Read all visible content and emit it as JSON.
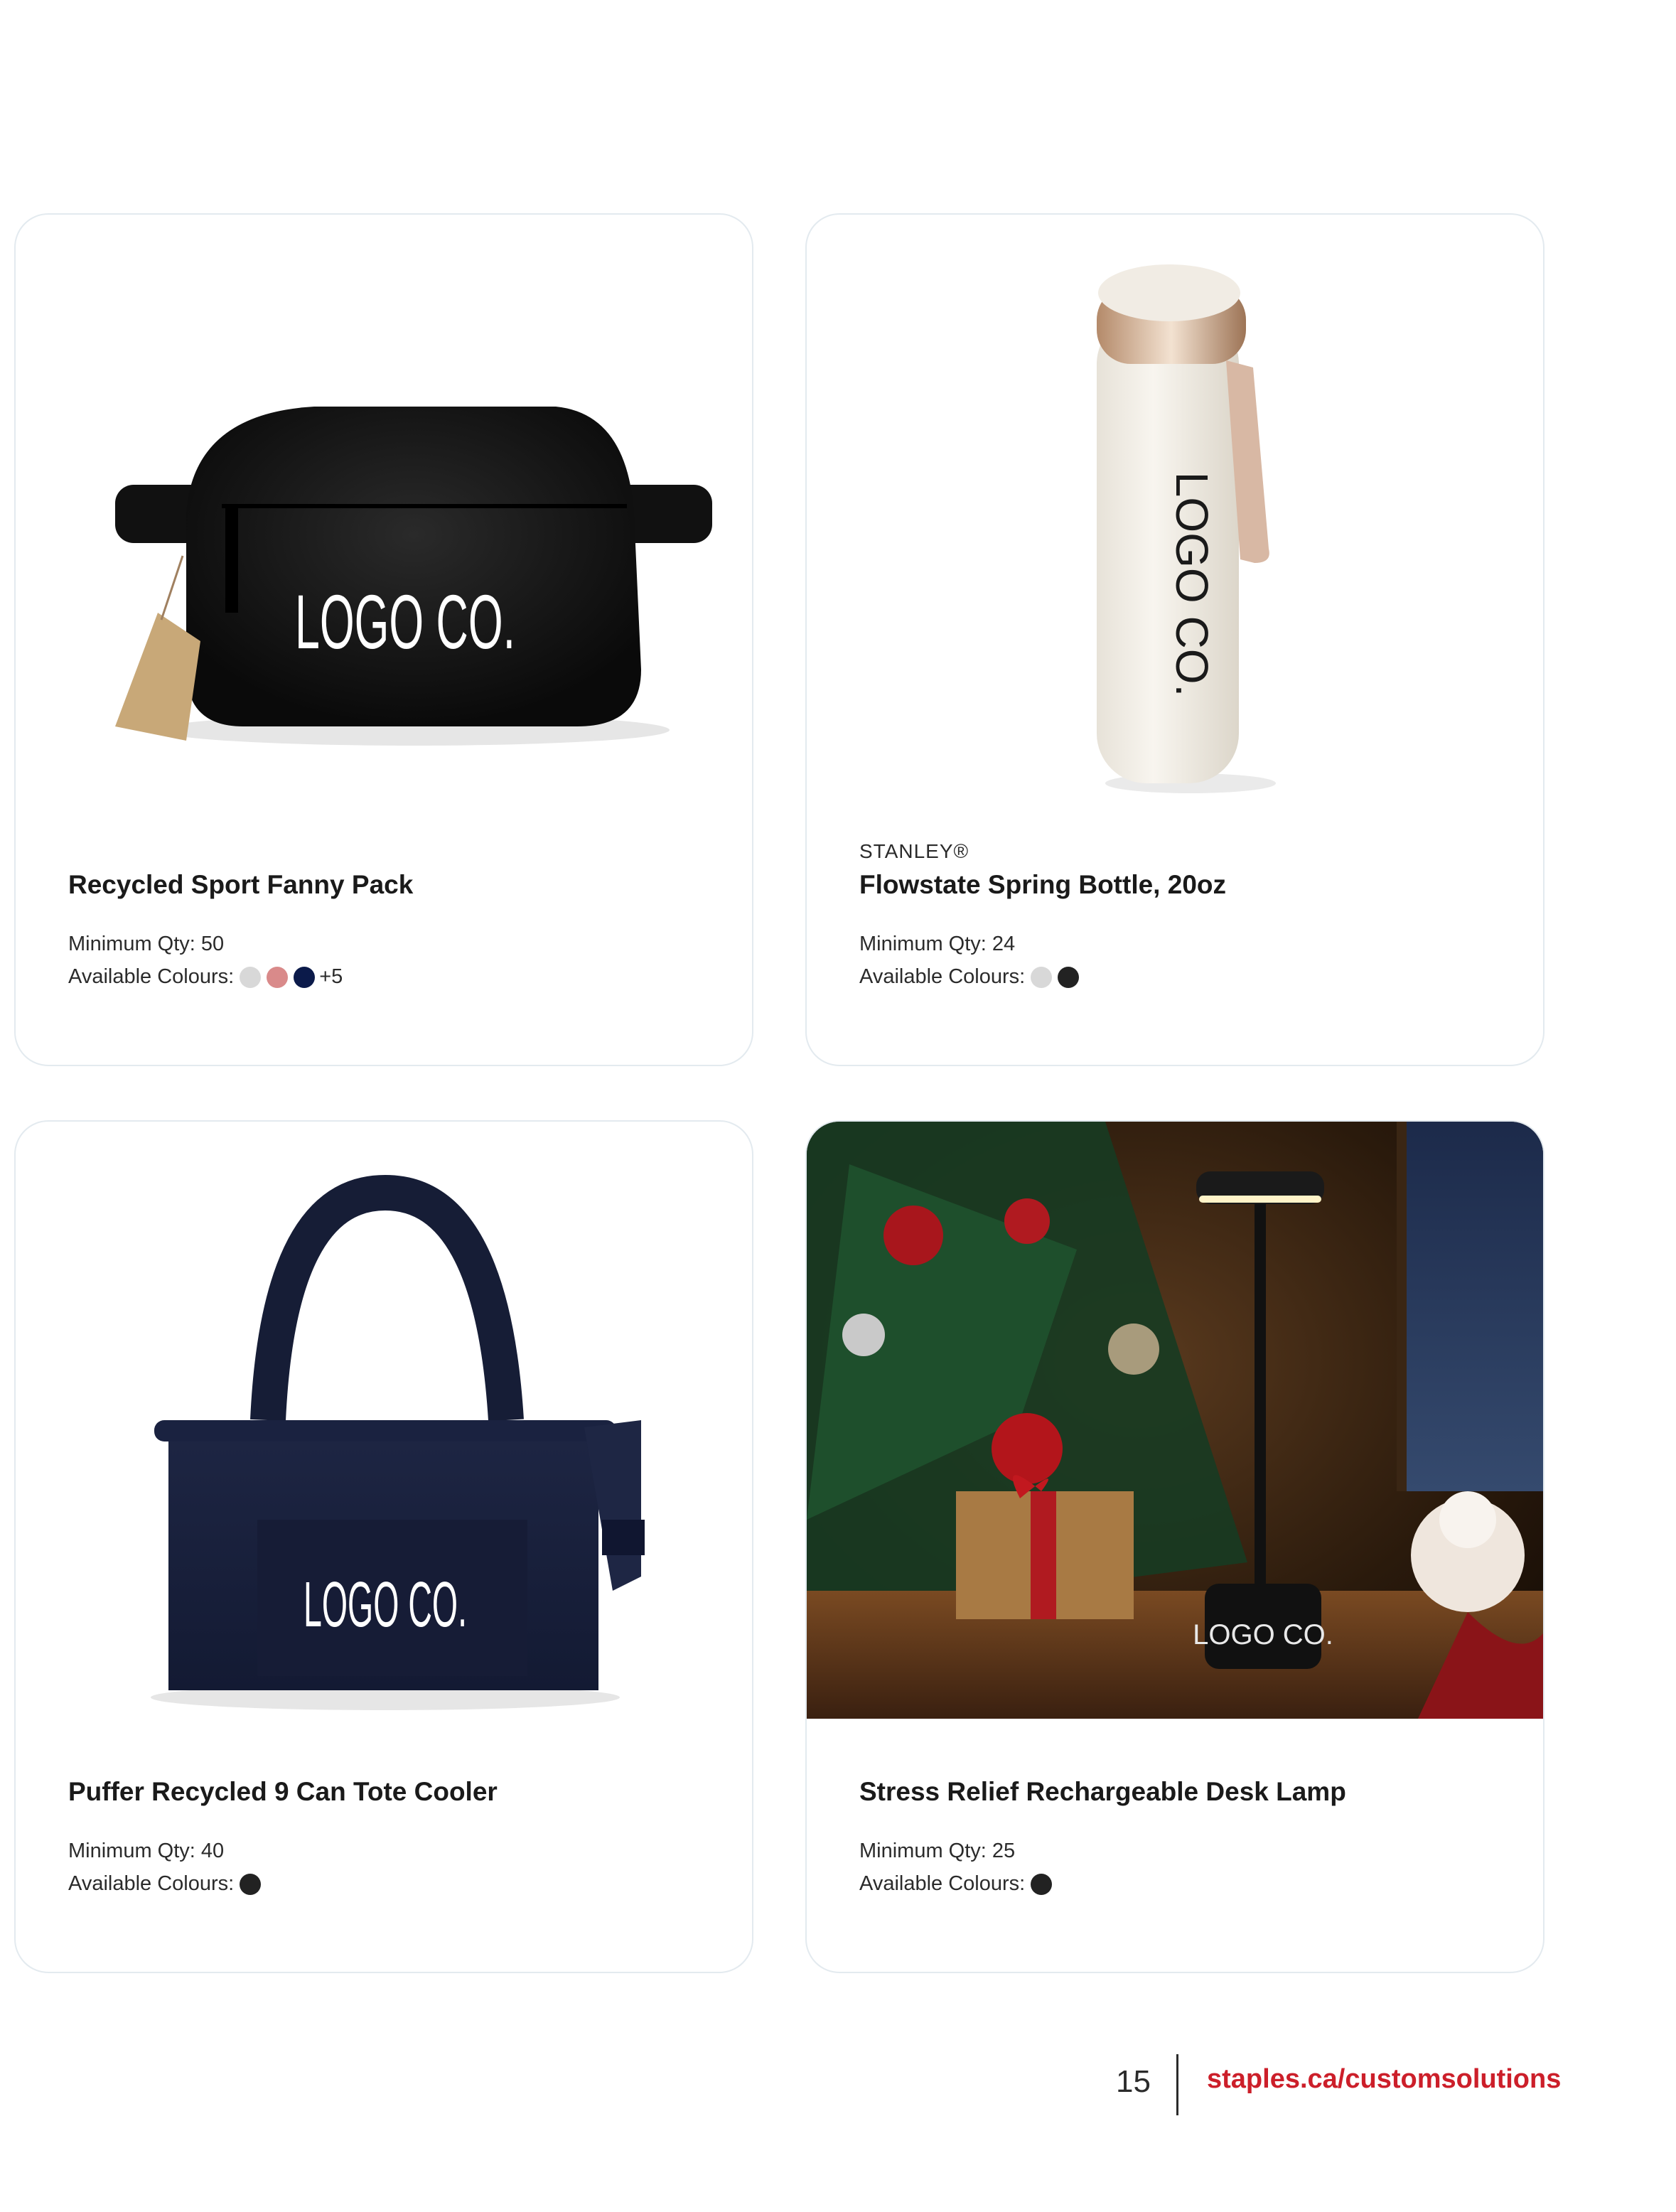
{
  "products": [
    {
      "brand": "",
      "title": "Recycled Sport Fanny Pack",
      "min_qty": "Minimum Qty: 50",
      "colours_label": "Available Colours:",
      "swatches": [
        "#d8d8d8",
        "#d98a8a",
        "#0b1a4a"
      ],
      "more": "+5",
      "image_logo": "LOGO CO."
    },
    {
      "brand": "STANLEY®",
      "title": "Flowstate Spring Bottle, 20oz",
      "min_qty": "Minimum Qty: 24",
      "colours_label": "Available Colours:",
      "swatches": [
        "#d8d8d8",
        "#222222"
      ],
      "more": "",
      "image_logo": "LOGO CO."
    },
    {
      "brand": "",
      "title": "Puffer Recycled 9 Can Tote Cooler",
      "min_qty": "Minimum Qty: 40",
      "colours_label": "Available Colours:",
      "swatches": [
        "#222222"
      ],
      "more": "",
      "image_logo": "LOGO CO."
    },
    {
      "brand": "",
      "title": "Stress Relief Rechargeable Desk Lamp",
      "min_qty": "Minimum Qty: 25",
      "colours_label": "Available Colours:",
      "swatches": [
        "#222222"
      ],
      "more": "",
      "image_logo": "LOGO CO."
    }
  ],
  "footer": {
    "page_number": "15",
    "link": "staples.ca/customsolutions"
  },
  "colors": {
    "brand_red": "#cc1f2a",
    "card_border": "#e3eaef"
  }
}
